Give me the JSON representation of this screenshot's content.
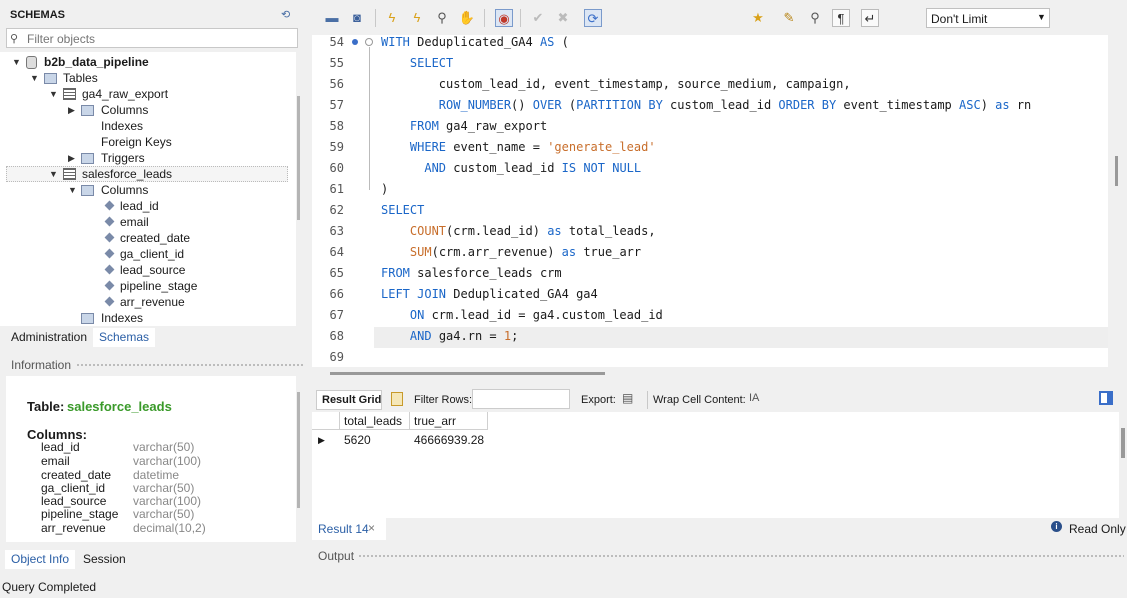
{
  "schemas_panel": {
    "title": "SCHEMAS",
    "filter_placeholder": "Filter objects",
    "tree": {
      "schema": "b2b_data_pipeline",
      "tables_label": "Tables",
      "table1": {
        "name": "ga4_raw_export",
        "children": [
          "Columns",
          "Indexes",
          "Foreign Keys",
          "Triggers"
        ]
      },
      "table2": {
        "name": "salesforce_leads",
        "columns_label": "Columns",
        "columns": [
          "lead_id",
          "email",
          "created_date",
          "ga_client_id",
          "lead_source",
          "pipeline_stage",
          "arr_revenue"
        ],
        "indexes_label": "Indexes"
      }
    },
    "tabs": [
      "Administration",
      "Schemas"
    ]
  },
  "info_panel": {
    "header": "Information",
    "table_label": "Table:",
    "table_name": "salesforce_leads",
    "columns_label": "Columns:",
    "columns": [
      {
        "name": "lead_id",
        "type": "varchar(50)"
      },
      {
        "name": "email",
        "type": "varchar(100)"
      },
      {
        "name": "created_date",
        "type": "datetime"
      },
      {
        "name": "ga_client_id",
        "type": "varchar(50)"
      },
      {
        "name": "lead_source",
        "type": "varchar(100)"
      },
      {
        "name": "pipeline_stage",
        "type": "varchar(50)"
      },
      {
        "name": "arr_revenue",
        "type": "decimal(10,2)"
      }
    ],
    "tabs": [
      "Object Info",
      "Session"
    ]
  },
  "status_bar": "Query Completed",
  "toolbar": {
    "limit_value": "Don't Limit",
    "icons": [
      "open-file-icon",
      "save-icon",
      "execute-icon",
      "execute-current-icon",
      "explain-icon",
      "stop-icon",
      "toggle-error-icon",
      "commit-icon",
      "rollback-icon",
      "autocommit-icon",
      "beautify-icon",
      "find-icon",
      "invisible-chars-icon",
      "wrap-icon"
    ]
  },
  "editor": {
    "lines": [
      {
        "n": "54",
        "parts": [
          [
            "kw",
            "WITH "
          ],
          [
            "",
            "Deduplicated_GA4 "
          ],
          [
            "kw",
            "AS"
          ],
          [
            "",
            " ("
          ]
        ]
      },
      {
        "n": "55",
        "parts": [
          [
            "",
            "    "
          ],
          [
            "kw",
            "SELECT"
          ]
        ]
      },
      {
        "n": "56",
        "parts": [
          [
            "",
            "        custom_lead_id, event_timestamp, source_medium, campaign,"
          ]
        ]
      },
      {
        "n": "57",
        "parts": [
          [
            "",
            "        "
          ],
          [
            "kw",
            "ROW_NUMBER"
          ],
          [
            "",
            "() "
          ],
          [
            "kw",
            "OVER"
          ],
          [
            "",
            " ("
          ],
          [
            "kw",
            "PARTITION BY"
          ],
          [
            "",
            " custom_lead_id "
          ],
          [
            "kw",
            "ORDER BY"
          ],
          [
            "",
            " event_timestamp "
          ],
          [
            "kw",
            "ASC"
          ],
          [
            "",
            ") "
          ],
          [
            "kw",
            "as"
          ],
          [
            "",
            " rn"
          ]
        ]
      },
      {
        "n": "58",
        "parts": [
          [
            "",
            "    "
          ],
          [
            "kw",
            "FROM"
          ],
          [
            "",
            " ga4_raw_export"
          ]
        ]
      },
      {
        "n": "59",
        "parts": [
          [
            "",
            "    "
          ],
          [
            "kw",
            "WHERE"
          ],
          [
            "",
            " event_name = "
          ],
          [
            "st",
            "'generate_lead'"
          ]
        ]
      },
      {
        "n": "60",
        "parts": [
          [
            "",
            "      "
          ],
          [
            "kw",
            "AND"
          ],
          [
            "",
            " custom_lead_id "
          ],
          [
            "kw",
            "IS NOT NULL"
          ]
        ]
      },
      {
        "n": "61",
        "parts": [
          [
            "",
            ")"
          ]
        ]
      },
      {
        "n": "62",
        "parts": [
          [
            "kw",
            "SELECT"
          ]
        ]
      },
      {
        "n": "63",
        "parts": [
          [
            "",
            "    "
          ],
          [
            "st",
            "COUNT"
          ],
          [
            "",
            "(crm.lead_id) "
          ],
          [
            "kw",
            "as"
          ],
          [
            "",
            " total_leads,"
          ]
        ]
      },
      {
        "n": "64",
        "parts": [
          [
            "",
            "    "
          ],
          [
            "st",
            "SUM"
          ],
          [
            "",
            "(crm.arr_revenue) "
          ],
          [
            "kw",
            "as"
          ],
          [
            "",
            " true_arr"
          ]
        ]
      },
      {
        "n": "65",
        "parts": [
          [
            "kw",
            "FROM"
          ],
          [
            "",
            " salesforce_leads crm"
          ]
        ]
      },
      {
        "n": "66",
        "parts": [
          [
            "kw",
            "LEFT JOIN"
          ],
          [
            "",
            " Deduplicated_GA4 ga4"
          ]
        ]
      },
      {
        "n": "67",
        "parts": [
          [
            "",
            "    "
          ],
          [
            "kw",
            "ON"
          ],
          [
            "",
            " crm.lead_id = ga4.custom_lead_id"
          ]
        ]
      },
      {
        "n": "68",
        "parts": [
          [
            "",
            "    "
          ],
          [
            "kw",
            "AND"
          ],
          [
            "",
            " ga4.rn = "
          ],
          [
            "nm",
            "1"
          ],
          [
            "",
            ";"
          ]
        ]
      },
      {
        "n": "69",
        "parts": []
      }
    ]
  },
  "result_toolbar": {
    "result_grid": "Result Grid",
    "filter_rows": "Filter Rows:",
    "export": "Export:",
    "wrap": "Wrap Cell Content:"
  },
  "result_grid": {
    "columns": [
      "total_leads",
      "true_arr"
    ],
    "rows": [
      [
        "5620",
        "46666939.28"
      ]
    ]
  },
  "result_tab": "Result 14",
  "read_only": "Read Only",
  "output_label": "Output",
  "colors": {
    "keyword": "#1a66c8",
    "string": "#c86e2b",
    "table_green": "#3a9a2a",
    "tab_blue": "#2b5fa6"
  }
}
